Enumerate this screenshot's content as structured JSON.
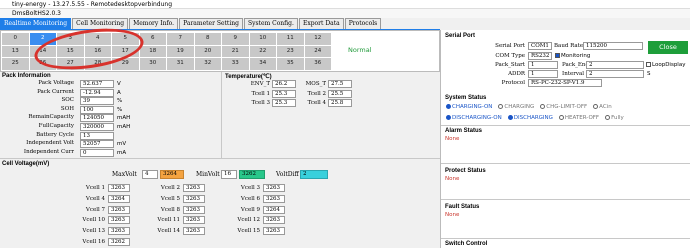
{
  "window": {
    "title": "tiny-energy - 13.27.5.55 - Remotedesktopverbindung",
    "subtitle": "DmsBoltHS2.0.3"
  },
  "tabs": [
    {
      "label": "Realtime Monitoring",
      "active": true
    },
    {
      "label": "Cell Monitoring",
      "active": false
    },
    {
      "label": "Memory Info.",
      "active": false
    },
    {
      "label": "Parameter Setting",
      "active": false
    },
    {
      "label": "System Config.",
      "active": false
    },
    {
      "label": "Export Data",
      "active": false
    },
    {
      "label": "Protocols",
      "active": false
    }
  ],
  "cells": [
    "0",
    "2",
    "3",
    "4",
    "5",
    "6",
    "7",
    "8",
    "9",
    "10",
    "11",
    "12",
    "13",
    "14",
    "15",
    "16",
    "17",
    "18",
    "19",
    "20",
    "21",
    "22",
    "23",
    "24",
    "25",
    "26",
    "27",
    "28",
    "29",
    "30",
    "31",
    "32",
    "33",
    "34",
    "35",
    "36"
  ],
  "selected_cell": "2",
  "status_text": "Normal",
  "pack_info": {
    "title": "Pack Information",
    "rows": [
      {
        "label": "Pack Voltage",
        "value": "52.637",
        "unit": "V"
      },
      {
        "label": "Pack Current",
        "value": "-12.94",
        "unit": "A"
      },
      {
        "label": "SOC",
        "value": "39",
        "unit": "%"
      },
      {
        "label": "SOH",
        "value": "100",
        "unit": "%"
      },
      {
        "label": "RemainCapacity",
        "value": "124050",
        "unit": "mAH"
      },
      {
        "label": "FullCapacity",
        "value": "320000",
        "unit": "mAH"
      },
      {
        "label": "Battery Cycle",
        "value": "13",
        "unit": ""
      },
      {
        "label": "Independent Volt",
        "value": "52057",
        "unit": "mV"
      },
      {
        "label": "Independent Curr",
        "value": "0",
        "unit": "mA"
      }
    ]
  },
  "temperature": {
    "title": "Temperature(℃)",
    "left": [
      {
        "label": "ENV_T",
        "value": "26.2"
      },
      {
        "label": "Tcell 1",
        "value": "25.3"
      },
      {
        "label": "Tcell 3",
        "value": "25.3"
      }
    ],
    "right": [
      {
        "label": "MOS_T",
        "value": "27.5"
      },
      {
        "label": "Tcell 2",
        "value": "25.5"
      },
      {
        "label": "Tcell 4",
        "value": "25.8"
      }
    ]
  },
  "cell_voltage": {
    "title": "Cell Voltage(mV)",
    "max_label": "MaxVolt",
    "max_cell": "4",
    "max_value": "3264",
    "min_label": "MinVolt",
    "min_cell": "16",
    "min_value": "3262",
    "diff_label": "VoltDiff",
    "diff_value": "2",
    "col1": [
      {
        "label": "Vcell 1",
        "value": "3263"
      },
      {
        "label": "Vcell 4",
        "value": "3264"
      },
      {
        "label": "Vcell 7",
        "value": "3263"
      },
      {
        "label": "Vcell 10",
        "value": "3263"
      },
      {
        "label": "Vcell 13",
        "value": "3263"
      },
      {
        "label": "Vcell 16",
        "value": "3262"
      }
    ],
    "col2": [
      {
        "label": "Vcell 2",
        "value": "3263"
      },
      {
        "label": "Vcell 5",
        "value": "3263"
      },
      {
        "label": "Vcell 8",
        "value": "3263"
      },
      {
        "label": "Vcell 11",
        "value": "3263"
      },
      {
        "label": "Vcell 14",
        "value": "3263"
      }
    ],
    "col3": [
      {
        "label": "Vcell 3",
        "value": "3263"
      },
      {
        "label": "Vcell 6",
        "value": "3263"
      },
      {
        "label": "Vcell 9",
        "value": "3264"
      },
      {
        "label": "Vcell 12",
        "value": "3263"
      },
      {
        "label": "Vcell 15",
        "value": "3263"
      }
    ]
  },
  "serial": {
    "title": "Serial Port",
    "port_label": "Serial Port",
    "port_value": "COM1",
    "baud_label": "Baud Rate",
    "baud_value": "115200",
    "close_label": "Close",
    "com_type_label": "COM Type",
    "com_type_value": "RS232",
    "monitoring_label": "Monitoring",
    "pack_start_label": "Pack_Start",
    "pack_start_value": "1",
    "pack_end_label": "Pack_End",
    "pack_end_value": "2",
    "loop_label": "LoopDisplay",
    "addr_label": "ADDR",
    "addr_value": "1",
    "interval_label": "Interval",
    "interval_value": "2",
    "interval_unit": "S",
    "protocol_label": "Protocol",
    "protocol_value": "RS-PC-232-SP-V1.9"
  },
  "system_status": {
    "title": "System Status",
    "row1": [
      {
        "label": "CHARGING-ON",
        "on": true
      },
      {
        "label": "CHARGING",
        "on": false
      },
      {
        "label": "CHG-LIMIT-OFF",
        "on": false
      },
      {
        "label": "ACin",
        "on": false
      }
    ],
    "row2": [
      {
        "label": "DISCHARGING-ON",
        "on": true
      },
      {
        "label": "DISCHARGING",
        "on": true
      },
      {
        "label": "HEATER-OFF",
        "on": false
      },
      {
        "label": "Fully",
        "on": false
      }
    ]
  },
  "alarm": {
    "title": "Alarm Status",
    "value": "None"
  },
  "protect": {
    "title": "Protect Status",
    "value": "None"
  },
  "fault": {
    "title": "Fault Status",
    "value": "None"
  },
  "switch_control": {
    "title": "Switch Control"
  },
  "colors": {
    "accent": "#1f7ee8",
    "close_button": "#1e9e3a",
    "max_bg": "#f4a340",
    "min_bg": "#28c78a",
    "diff_bg": "#38d0dc",
    "annotation": "#d8322c"
  }
}
